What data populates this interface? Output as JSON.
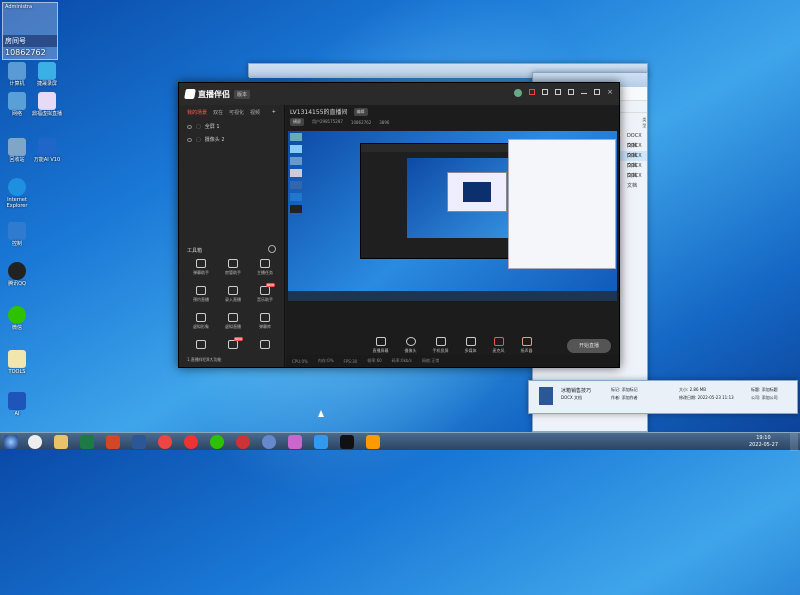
{
  "desktop": {
    "room_label": "房间号",
    "room_number": "10862762",
    "admin_label": "Administra",
    "icons": [
      {
        "label": "计算机",
        "name": "computer-icon"
      },
      {
        "label": "捷晟录屏",
        "name": "recorder-icon"
      },
      {
        "label": "网络",
        "name": "network-icon"
      },
      {
        "label": "鼎福虚拟直播",
        "name": "virtual-live-icon"
      },
      {
        "label": "回收站",
        "name": "recycle-bin-icon"
      },
      {
        "label": "万能AI V10",
        "name": "ai-icon"
      },
      {
        "label": "Internet Explorer",
        "name": "ie-icon"
      },
      {
        "label": "控制",
        "name": "control-icon"
      },
      {
        "label": "腾讯QQ",
        "name": "qq-icon"
      },
      {
        "label": "微信",
        "name": "wechat-icon"
      },
      {
        "label": "TOOLS",
        "name": "tools-icon"
      },
      {
        "label": "AI",
        "name": "ai-sub-icon"
      },
      {
        "label": "Hilo",
        "name": "hilo-icon"
      }
    ]
  },
  "explorer": {
    "breadcrumb": "« 新建文件夹 ▸ 红旗 ▸ 红旗 ▸ 4. 腾讯 办 拆",
    "col_date": "修改日期",
    "col_type": "类型",
    "rows": [
      {
        "date": "2022-04-11 1:15",
        "type": "DOCX 文档"
      },
      {
        "date": "2022-04-01 18:10",
        "type": "DOCX 文档"
      },
      {
        "date": "2022-05-23 11:13",
        "type": "DOCX 文档"
      },
      {
        "date": "2022-05-11 3:29",
        "type": "DOCX 文档"
      },
      {
        "date": "2022-05-23 11:04",
        "type": "DOCX 文档"
      }
    ],
    "stub": "介绍",
    "detail": {
      "filename": "冰箱销售技巧",
      "filetype": "DOCX 文档",
      "tags": "标记: 添加标记",
      "author": "作者: 添加作者",
      "size": "大小: 2.86 MB",
      "modified": "修改日期: 2022-05-23 11:13",
      "title": "标题: 添加标题",
      "company": "公司: 添加公司"
    }
  },
  "app": {
    "name": "直播伴侣",
    "version": "版本",
    "tabs": [
      "我的场景",
      "双在",
      "可视化",
      "视频"
    ],
    "scenes": [
      "全屏 1",
      "摄像头 2"
    ],
    "toolbox_title": "工具箱",
    "tools": [
      {
        "label": "弹幕助手",
        "badge": ""
      },
      {
        "label": "房管助手",
        "badge": ""
      },
      {
        "label": "主播任务",
        "badge": ""
      },
      {
        "label": "预约直播",
        "badge": ""
      },
      {
        "label": "录入直播",
        "badge": ""
      },
      {
        "label": "音乐助手",
        "badge": "NEW"
      },
      {
        "label": "虚拟形象",
        "badge": ""
      },
      {
        "label": "虚拟直播",
        "badge": ""
      },
      {
        "label": "弹幕库",
        "badge": ""
      },
      {
        "label": "",
        "badge": ""
      },
      {
        "label": "",
        "badge": "NEW"
      },
      {
        "label": "",
        "badge": ""
      }
    ],
    "notice": "1.直播伴侣8大功能",
    "room_title": "LV1314155的直播间",
    "title_tag": "编辑",
    "mode_pill": "横屏",
    "user_id": "用户298175287",
    "room_id": "10862762",
    "fans": "3896",
    "controls": [
      "直播屏幕",
      "摄像头",
      "手机投屏",
      "多媒体",
      "麦克风",
      "扬声器"
    ],
    "start_label": "开始直播",
    "status": [
      "CPU:0%",
      "内存:0%",
      "FPS:30",
      "帧率:60",
      "码率:0kb/s",
      "网络:正常"
    ]
  },
  "taskbar": {
    "time": "19:10",
    "date": "2022-05-27"
  }
}
